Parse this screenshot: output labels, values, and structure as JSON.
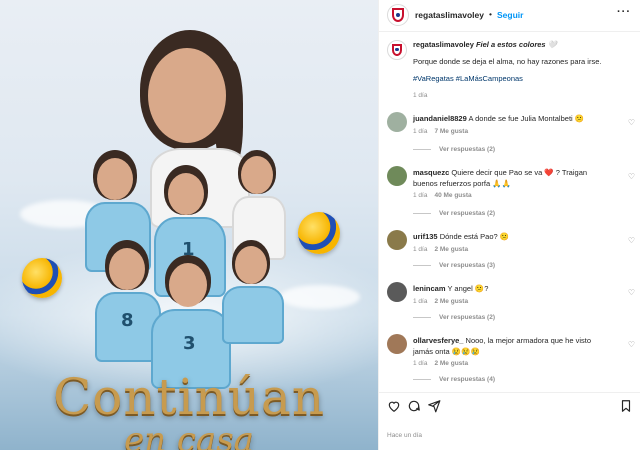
{
  "poster": {
    "title_line1": "Continúan",
    "title_line2": "en casa",
    "jersey_numbers": [
      "1",
      "8",
      "3"
    ],
    "colors": {
      "title_gold": "#c79b4f",
      "jersey_blue": "#8ec9e6",
      "ball_yellow": "#f7b500",
      "ball_blue": "#1f4fb5"
    }
  },
  "header": {
    "username": "regataslimavoley",
    "separator": "•",
    "follow_label": "Seguir",
    "more_label": "···"
  },
  "caption": {
    "username": "regataslimavoley",
    "headline": "Fiel a estos colores 🤍",
    "text": "Porque donde se deja el alma, no hay razones para irse.",
    "hashtags": "#VaRegatas #LaMásCampeonas",
    "time": "1 día"
  },
  "comments": [
    {
      "username": "juandaniel8829",
      "text": "A donde se fue Julia Montalbeti 😕",
      "time": "1 día",
      "likes": "7 Me gusta",
      "reply_label": "Responder",
      "replies": "Ver respuestas (2)"
    },
    {
      "username": "masquezc",
      "text": "Quiere decir que Pao se va ❤️ ? Traigan buenos refuerzos porfa 🙏🙏",
      "time": "1 día",
      "likes": "40 Me gusta",
      "reply_label": "Responder",
      "replies": "Ver respuestas (2)"
    },
    {
      "username": "urif135",
      "text": "Dónde está Pao? 😕",
      "time": "1 día",
      "likes": "2 Me gusta",
      "reply_label": "Responder",
      "replies": "Ver respuestas (3)"
    },
    {
      "username": "lenincam",
      "text": "Y angel 😕?",
      "time": "1 día",
      "likes": "2 Me gusta",
      "reply_label": "Responder",
      "replies": "Ver respuestas (2)"
    },
    {
      "username": "ollarvesferye_",
      "text": "Nooo, la mejor armadora que he visto jamás onta 😢😢😢",
      "time": "1 día",
      "likes": "2 Me gusta",
      "reply_label": "Responder",
      "replies": "Ver respuestas (4)"
    }
  ],
  "actions": {
    "like_icon": "heart-icon",
    "comment_icon": "comment-icon",
    "share_icon": "share-icon",
    "save_icon": "bookmark-icon"
  },
  "footer": {
    "time": "Hace un día"
  },
  "icons": {
    "comment_like": "♡"
  }
}
